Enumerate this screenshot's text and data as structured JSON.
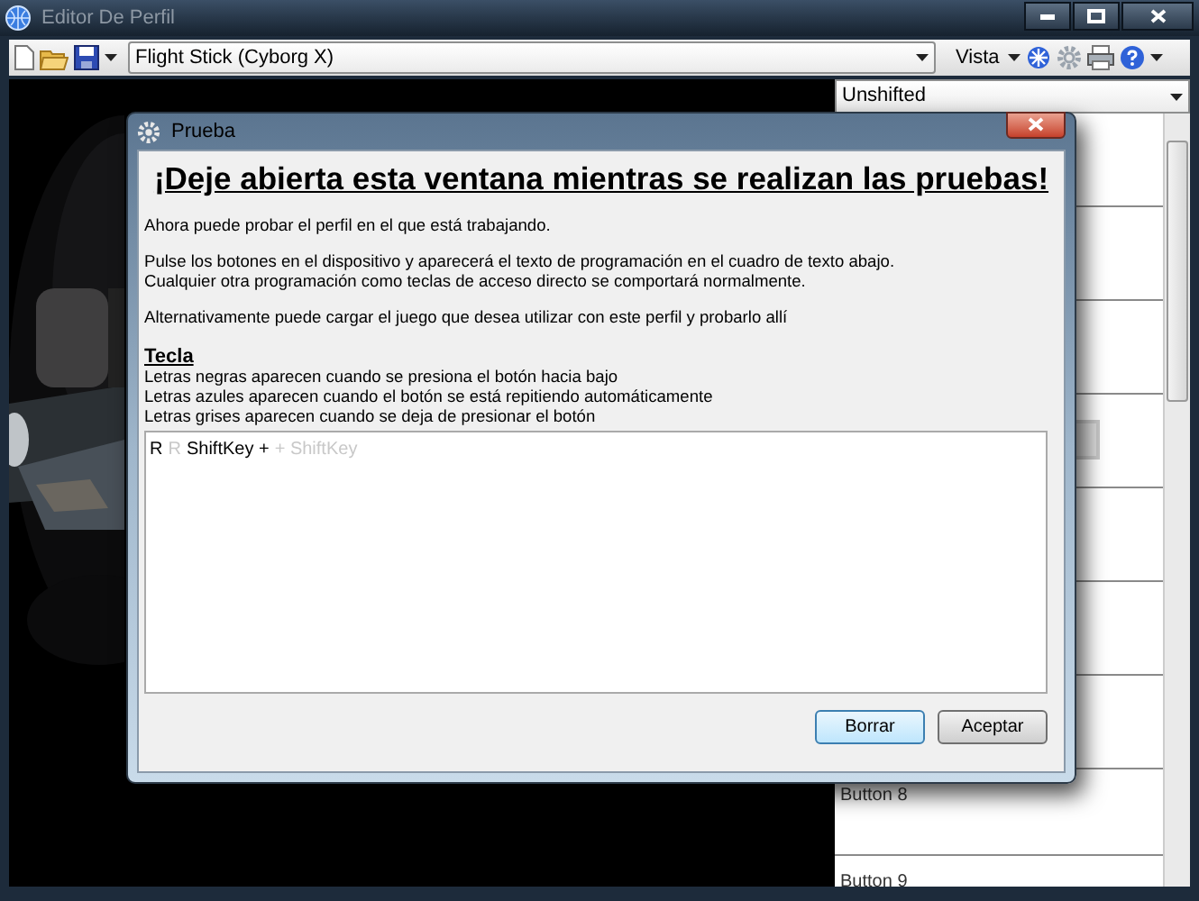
{
  "window": {
    "title": "Editor De Perfil"
  },
  "toolbar": {
    "profile": "Flight Stick (Cyborg X)",
    "view_menu": "Vista"
  },
  "mode_dropdown": {
    "value": "Unshifted"
  },
  "button_rows": [
    {
      "label": "Button 8"
    },
    {
      "label": "Button 9"
    }
  ],
  "dialog": {
    "title": "Prueba",
    "heading": "¡Deje abierta esta ventana mientras se realizan las pruebas!",
    "paragraphs": [
      [
        "Ahora puede probar el perfil en el que está trabajando."
      ],
      [
        "Pulse los botones en el dispositivo y aparecerá el texto de programación en el cuadro de texto abajo.",
        "Cualquier otra programación como teclas de acceso directo se comportará normalmente."
      ],
      [
        "Alternativamente puede cargar el juego que desea utilizar con este perfil y probarlo allí"
      ]
    ],
    "legend_title": "Tecla",
    "legend": [
      "Letras negras aparecen cuando se presiona el botón hacia bajo",
      "Letras azules aparecen cuando el botón se está repitiendo automáticamente",
      "Letras grises aparecen cuando se deja de presionar el botón"
    ],
    "key_log": [
      {
        "text": "R",
        "kind": "down"
      },
      {
        "text": "R",
        "kind": "up"
      },
      {
        "text": "ShiftKey +",
        "kind": "down"
      },
      {
        "text": "+ ShiftKey",
        "kind": "up"
      }
    ],
    "buttons": [
      {
        "label": "Borrar",
        "focused": true
      },
      {
        "label": "Aceptar",
        "focused": false
      }
    ]
  }
}
